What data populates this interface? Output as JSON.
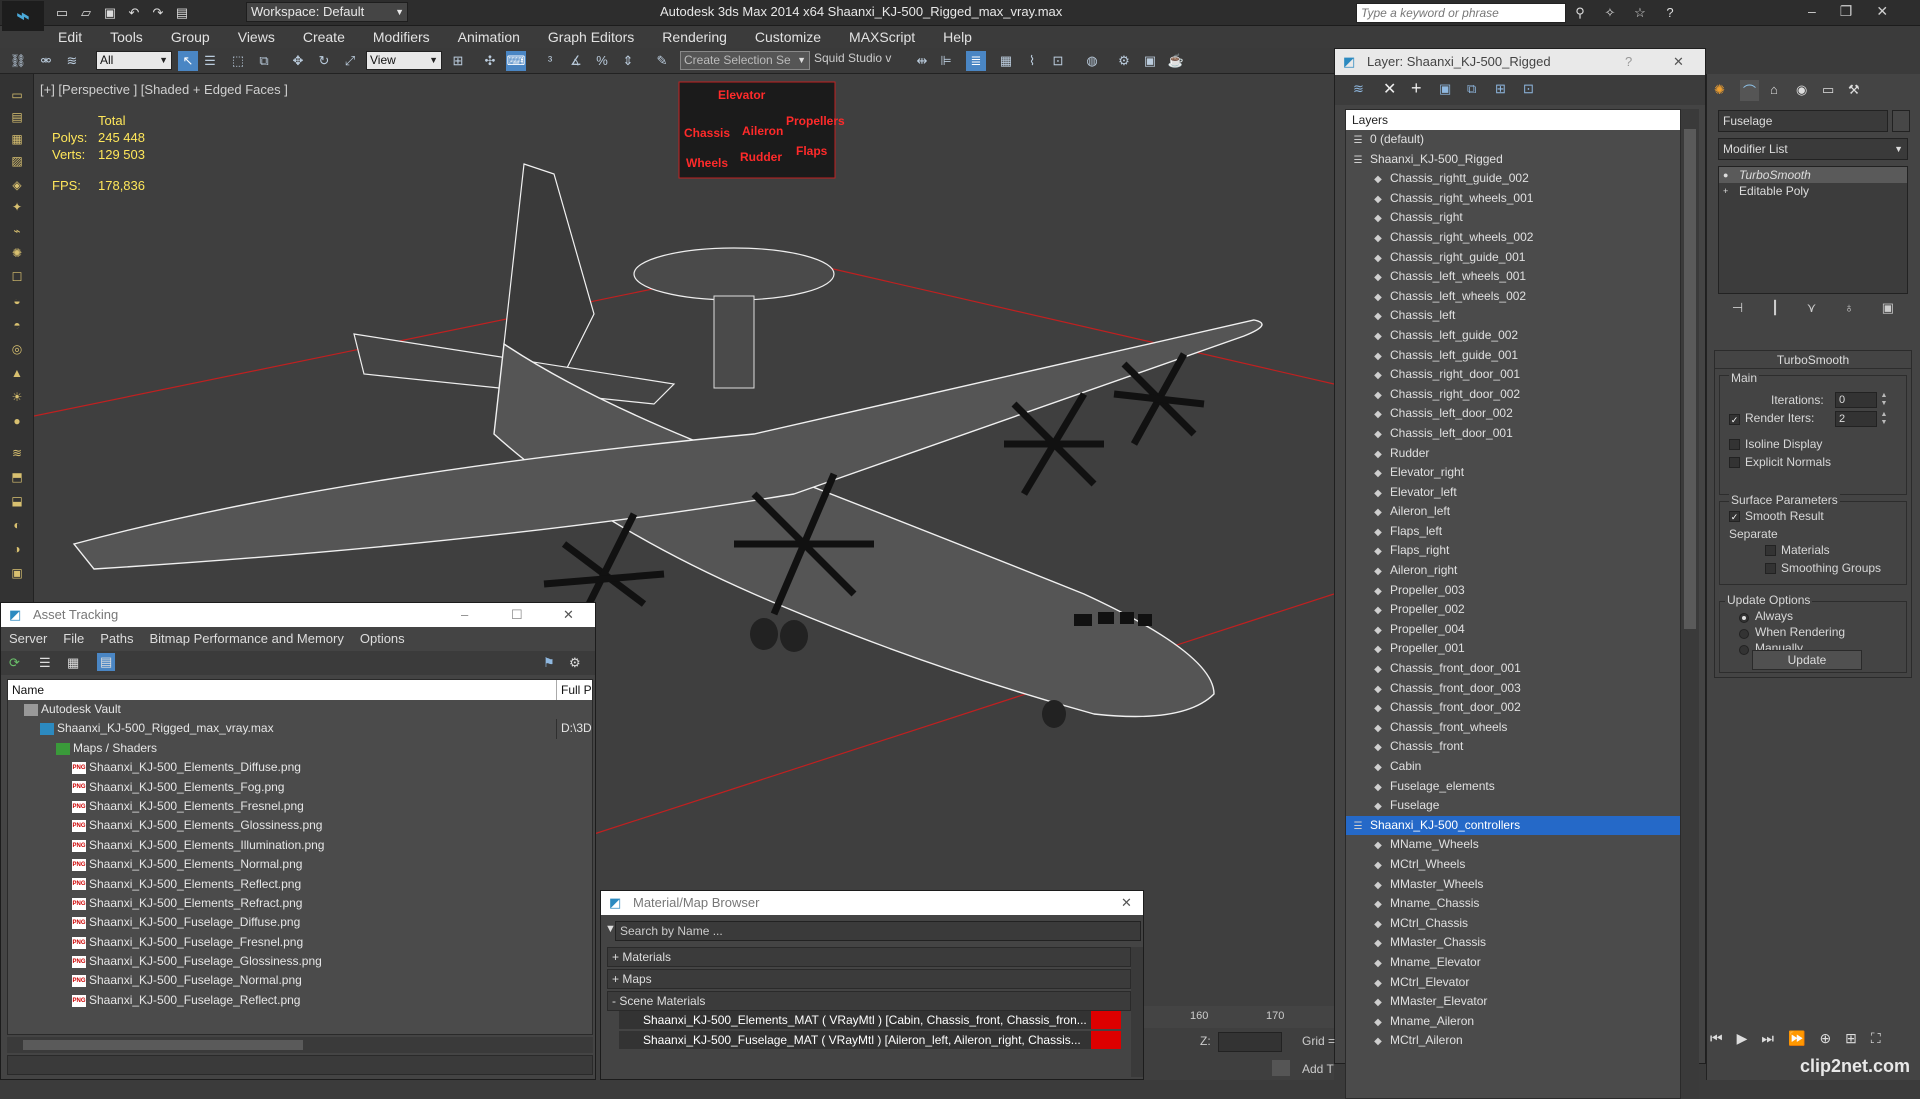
{
  "app": {
    "title": "Autodesk 3ds Max  2014 x64     Shaanxi_KJ-500_Rigged_max_vray.max",
    "workspace": "Workspace: Default",
    "search_placeholder": "Type a keyword or phrase"
  },
  "menu": [
    "Edit",
    "Tools",
    "Group",
    "Views",
    "Create",
    "Modifiers",
    "Animation",
    "Graph Editors",
    "Rendering",
    "Customize",
    "MAXScript",
    "Help"
  ],
  "toolbar": {
    "filter": "All",
    "ref_coord": "View",
    "selection_set_placeholder": "Create Selection Se",
    "squid": "Squid Studio v"
  },
  "viewport": {
    "label": "[+] [Perspective ] [Shaded + Edged Faces ]",
    "stats": {
      "total_label": "Total",
      "polys_label": "Polys:",
      "polys": "245 448",
      "verts_label": "Verts:",
      "verts": "129 503",
      "fps_label": "FPS:",
      "fps": "178,836"
    },
    "control_panel": [
      "Elevator",
      "Chassis",
      "Aileron",
      "Propellers",
      "Wheels",
      "Rudder",
      "Flaps"
    ]
  },
  "layers": {
    "title": "Layer: Shaanxi_KJ-500_Rigged",
    "column": "Layers",
    "rows": [
      {
        "label": "0 (default)",
        "level": 1,
        "type": "layer"
      },
      {
        "label": "Shaanxi_KJ-500_Rigged",
        "level": 1,
        "type": "layer"
      },
      {
        "label": "Chassis_rightt_guide_002",
        "level": 2
      },
      {
        "label": "Chassis_right_wheels_001",
        "level": 2
      },
      {
        "label": "Chassis_right",
        "level": 2
      },
      {
        "label": "Chassis_right_wheels_002",
        "level": 2
      },
      {
        "label": "Chassis_right_guide_001",
        "level": 2
      },
      {
        "label": "Chassis_left_wheels_001",
        "level": 2
      },
      {
        "label": "Chassis_left_wheels_002",
        "level": 2
      },
      {
        "label": "Chassis_left",
        "level": 2
      },
      {
        "label": "Chassis_left_guide_002",
        "level": 2
      },
      {
        "label": "Chassis_left_guide_001",
        "level": 2
      },
      {
        "label": "Chassis_right_door_001",
        "level": 2
      },
      {
        "label": "Chassis_right_door_002",
        "level": 2
      },
      {
        "label": "Chassis_left_door_002",
        "level": 2
      },
      {
        "label": "Chassis_left_door_001",
        "level": 2
      },
      {
        "label": "Rudder",
        "level": 2
      },
      {
        "label": "Elevator_right",
        "level": 2
      },
      {
        "label": "Elevator_left",
        "level": 2
      },
      {
        "label": "Aileron_left",
        "level": 2
      },
      {
        "label": "Flaps_left",
        "level": 2
      },
      {
        "label": "Flaps_right",
        "level": 2
      },
      {
        "label": "Aileron_right",
        "level": 2
      },
      {
        "label": "Propeller_003",
        "level": 2
      },
      {
        "label": "Propeller_002",
        "level": 2
      },
      {
        "label": "Propeller_004",
        "level": 2
      },
      {
        "label": "Propeller_001",
        "level": 2
      },
      {
        "label": "Chassis_front_door_001",
        "level": 2
      },
      {
        "label": "Chassis_front_door_003",
        "level": 2
      },
      {
        "label": "Chassis_front_door_002",
        "level": 2
      },
      {
        "label": "Chassis_front_wheels",
        "level": 2
      },
      {
        "label": "Chassis_front",
        "level": 2
      },
      {
        "label": "Cabin",
        "level": 2
      },
      {
        "label": "Fuselage_elements",
        "level": 2
      },
      {
        "label": "Fuselage",
        "level": 2
      },
      {
        "label": "Shaanxi_KJ-500_controllers",
        "level": 1,
        "type": "layer",
        "selected": true
      },
      {
        "label": "MName_Wheels",
        "level": 2
      },
      {
        "label": "MCtrl_Wheels",
        "level": 2
      },
      {
        "label": "MMaster_Wheels",
        "level": 2
      },
      {
        "label": "Mname_Chassis",
        "level": 2
      },
      {
        "label": "MCtrl_Chassis",
        "level": 2
      },
      {
        "label": "MMaster_Chassis",
        "level": 2
      },
      {
        "label": "Mname_Elevator",
        "level": 2
      },
      {
        "label": "MCtrl_Elevator",
        "level": 2
      },
      {
        "label": "MMaster_Elevator",
        "level": 2
      },
      {
        "label": "Mname_Aileron",
        "level": 2
      },
      {
        "label": "MCtrl_Aileron",
        "level": 2
      }
    ]
  },
  "command_panel": {
    "object_name": "Fuselage",
    "modifier_list": "Modifier List",
    "stack": [
      "TurboSmooth",
      "Editable Poly"
    ],
    "turbosmooth": {
      "title": "TurboSmooth",
      "main": "Main",
      "iterations_label": "Iterations:",
      "iterations": "0",
      "render_iters_label": "Render Iters:",
      "render_iters": "2",
      "isoline": "Isoline Display",
      "explicit": "Explicit Normals",
      "surface": "Surface Parameters",
      "smooth": "Smooth Result",
      "separate": "Separate",
      "materials": "Materials",
      "smoothing_groups": "Smoothing Groups",
      "update_options": "Update Options",
      "always": "Always",
      "when_rendering": "When Rendering",
      "manually": "Manually",
      "update": "Update"
    }
  },
  "asset_tracking": {
    "title": "Asset Tracking",
    "menu": [
      "Server",
      "File",
      "Paths",
      "Bitmap Performance and Memory",
      "Options"
    ],
    "col_name": "Name",
    "col_full": "Full Pa",
    "rows": [
      {
        "label": "Autodesk Vault",
        "indent": 1,
        "icon": "vault"
      },
      {
        "label": "Shaanxi_KJ-500_Rigged_max_vray.max",
        "indent": 2,
        "icon": "max",
        "full": "D:\\3D"
      },
      {
        "label": "Maps / Shaders",
        "indent": 3,
        "icon": "maps"
      },
      {
        "label": "Shaanxi_KJ-500_Elements_Diffuse.png",
        "indent": 4,
        "icon": "png"
      },
      {
        "label": "Shaanxi_KJ-500_Elements_Fog.png",
        "indent": 4,
        "icon": "png"
      },
      {
        "label": "Shaanxi_KJ-500_Elements_Fresnel.png",
        "indent": 4,
        "icon": "png"
      },
      {
        "label": "Shaanxi_KJ-500_Elements_Glossiness.png",
        "indent": 4,
        "icon": "png"
      },
      {
        "label": "Shaanxi_KJ-500_Elements_Illumination.png",
        "indent": 4,
        "icon": "png"
      },
      {
        "label": "Shaanxi_KJ-500_Elements_Normal.png",
        "indent": 4,
        "icon": "png"
      },
      {
        "label": "Shaanxi_KJ-500_Elements_Reflect.png",
        "indent": 4,
        "icon": "png"
      },
      {
        "label": "Shaanxi_KJ-500_Elements_Refract.png",
        "indent": 4,
        "icon": "png"
      },
      {
        "label": "Shaanxi_KJ-500_Fuselage_Diffuse.png",
        "indent": 4,
        "icon": "png"
      },
      {
        "label": "Shaanxi_KJ-500_Fuselage_Fresnel.png",
        "indent": 4,
        "icon": "png"
      },
      {
        "label": "Shaanxi_KJ-500_Fuselage_Glossiness.png",
        "indent": 4,
        "icon": "png"
      },
      {
        "label": "Shaanxi_KJ-500_Fuselage_Normal.png",
        "indent": 4,
        "icon": "png"
      },
      {
        "label": "Shaanxi_KJ-500_Fuselage_Reflect.png",
        "indent": 4,
        "icon": "png"
      }
    ]
  },
  "material_browser": {
    "title": "Material/Map Browser",
    "search_placeholder": "Search by Name ...",
    "sections": [
      "+ Materials",
      "+ Maps",
      "- Scene Materials"
    ],
    "materials": [
      "Shaanxi_KJ-500_Elements_MAT ( VRayMtl ) [Cabin, Chassis_front, Chassis_fron...",
      "Shaanxi_KJ-500_Fuselage_MAT ( VRayMtl ) [Aileron_left, Aileron_right, Chassis..."
    ]
  },
  "status": {
    "ruler": [
      "160",
      "170"
    ],
    "z_label": "Z:",
    "grid": "Grid =",
    "add_time": "Add T"
  },
  "watermark": "clip2net.com"
}
